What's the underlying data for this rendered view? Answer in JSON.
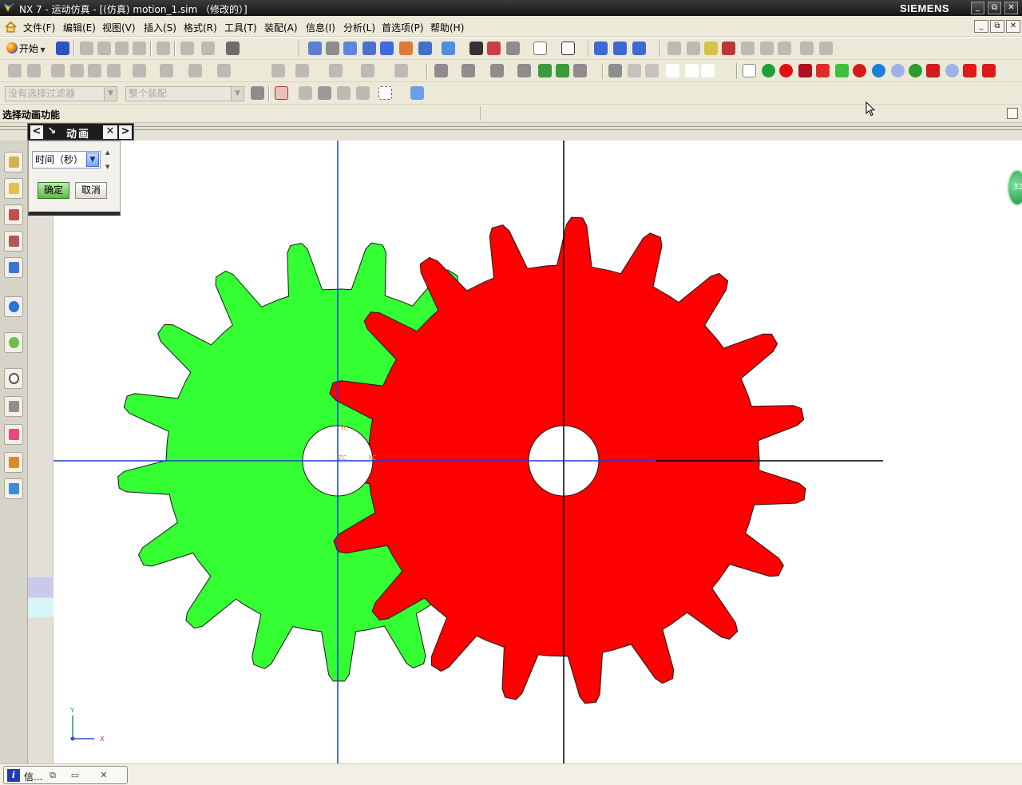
{
  "window": {
    "title": "NX 7 - 运动仿真 - [(仿真) motion_1.sim （修改的）]",
    "brand": "SIEMENS",
    "controls": [
      "_",
      "⧉",
      "✕"
    ]
  },
  "menu": {
    "items": [
      "文件(F)",
      "编辑(E)",
      "视图(V)",
      "插入(S)",
      "格式(R)",
      "工具(T)",
      "装配(A)",
      "信息(I)",
      "分析(L)",
      "首选项(P)",
      "帮助(H)"
    ],
    "mdi_controls": [
      "_",
      "⧉",
      "✕"
    ]
  },
  "toolbar": {
    "start_label": "开始",
    "filter_select": "没有选择过滤器",
    "assembly_select": "整个装配"
  },
  "cue_line": {
    "text": "选择动画功能"
  },
  "dialog": {
    "title": "动画",
    "select_value": "时间（秒）",
    "ok_label": "确定",
    "cancel_label": "取消"
  },
  "canvas": {
    "wcs": {
      "x": "X",
      "y": "Y"
    },
    "csys_labels": {
      "yc": "YC",
      "zc": "ZC",
      "xc": "XC"
    },
    "gear_left_color": "#33ff33",
    "gear_right_color": "#ff0000",
    "axis_blue": "#1a3fd8"
  },
  "float_badge": "32",
  "statusbar": {
    "info_label": "信..."
  }
}
